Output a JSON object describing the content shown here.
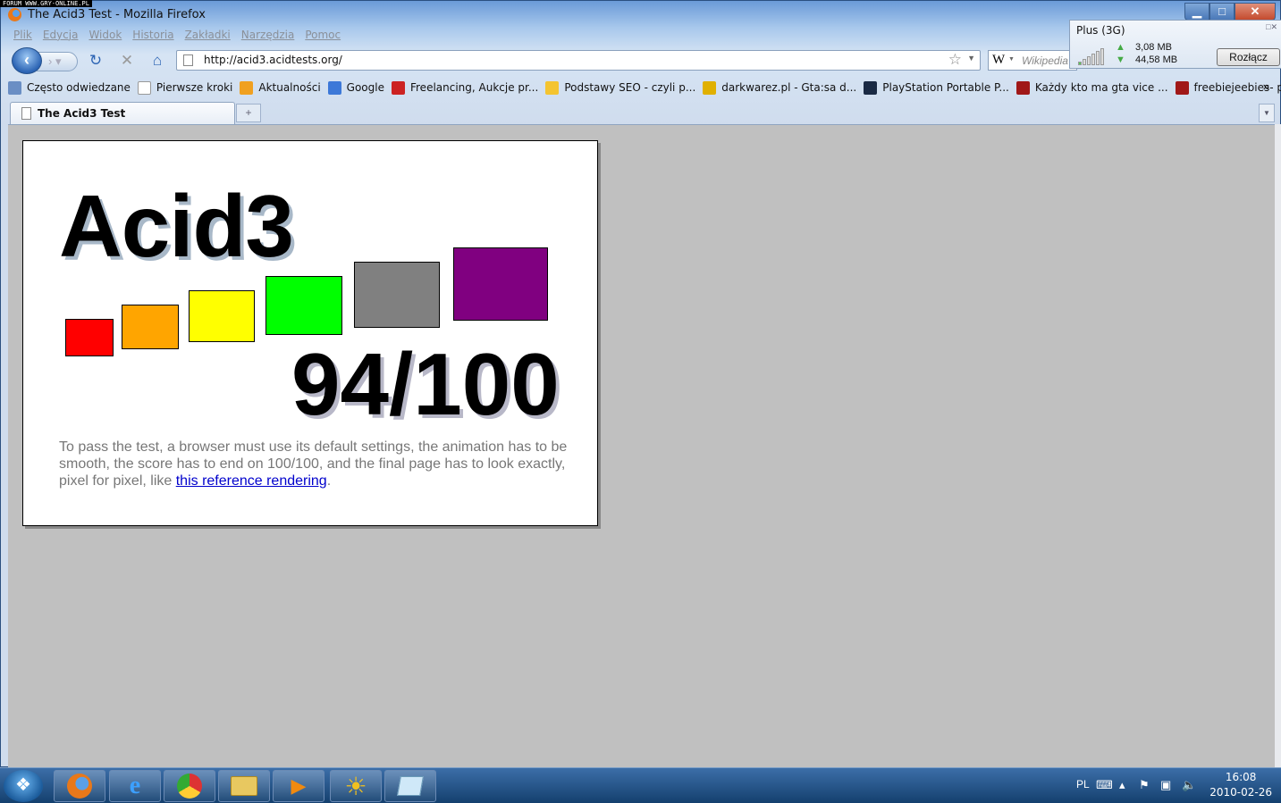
{
  "watermark": "FORUM WWW.GRY-ONLINE.PL",
  "window": {
    "title": "The Acid3 Test - Mozilla Firefox"
  },
  "menu": [
    "Plik",
    "Edycja",
    "Widok",
    "Historia",
    "Zakładki",
    "Narzędzia",
    "Pomoc"
  ],
  "nav": {
    "url": "http://acid3.acidtests.org/",
    "search_engine": "W",
    "search_placeholder": "Wikipedia"
  },
  "bookmarks": [
    {
      "label": "Często odwiedzane",
      "icon": "most-visited-icon",
      "color": "#6a8ec4"
    },
    {
      "label": "Pierwsze kroki",
      "icon": "page-icon",
      "color": "#ffffff"
    },
    {
      "label": "Aktualności",
      "icon": "rss-icon",
      "color": "#f0a020"
    },
    {
      "label": "Google",
      "icon": "google-icon",
      "color": "#3c78d8"
    },
    {
      "label": "Freelancing, Aukcje pr...",
      "icon": "dots-icon",
      "color": "#cc2222"
    },
    {
      "label": "Podstawy SEO - czyli p...",
      "icon": "seo-icon",
      "color": "#f4c430"
    },
    {
      "label": "darkwarez.pl - Gta:sa d...",
      "icon": "darkwarez-icon",
      "color": "#e0b000"
    },
    {
      "label": "PlayStation Portable P...",
      "icon": "psp-icon",
      "color": "#1a2a44"
    },
    {
      "label": "Każdy kto ma gta vice ...",
      "icon": "g-icon",
      "color": "#a01818"
    },
    {
      "label": "freebiejeebies- pytanie",
      "icon": "g-icon",
      "color": "#a01818"
    }
  ],
  "tab": {
    "title": "The Acid3 Test",
    "new_tab": "+"
  },
  "connection": {
    "name": "Plus (3G)",
    "sent": "3,08 MB",
    "received": "44,58 MB",
    "disconnect": "Rozłącz"
  },
  "acid3": {
    "heading": "Acid3",
    "score": "94/100",
    "desc_pre": "To pass the test, a browser must use its default settings, the animation has to be smooth, the score has to end on 100/100, and the final page has to look exactly, pixel for pixel, like ",
    "link": "this reference rendering",
    "desc_post": ".",
    "boxes": [
      {
        "name": "red-box",
        "color": "#ff0000"
      },
      {
        "name": "orange-box",
        "color": "#ffa500"
      },
      {
        "name": "yellow-box",
        "color": "#ffff00"
      },
      {
        "name": "lime-box",
        "color": "#00ff00"
      },
      {
        "name": "gray-box",
        "color": "#808080"
      },
      {
        "name": "purple-box",
        "color": "#800080"
      }
    ]
  },
  "taskbar": {
    "lang": "PL",
    "time": "16:08",
    "date": "2010-02-26"
  }
}
